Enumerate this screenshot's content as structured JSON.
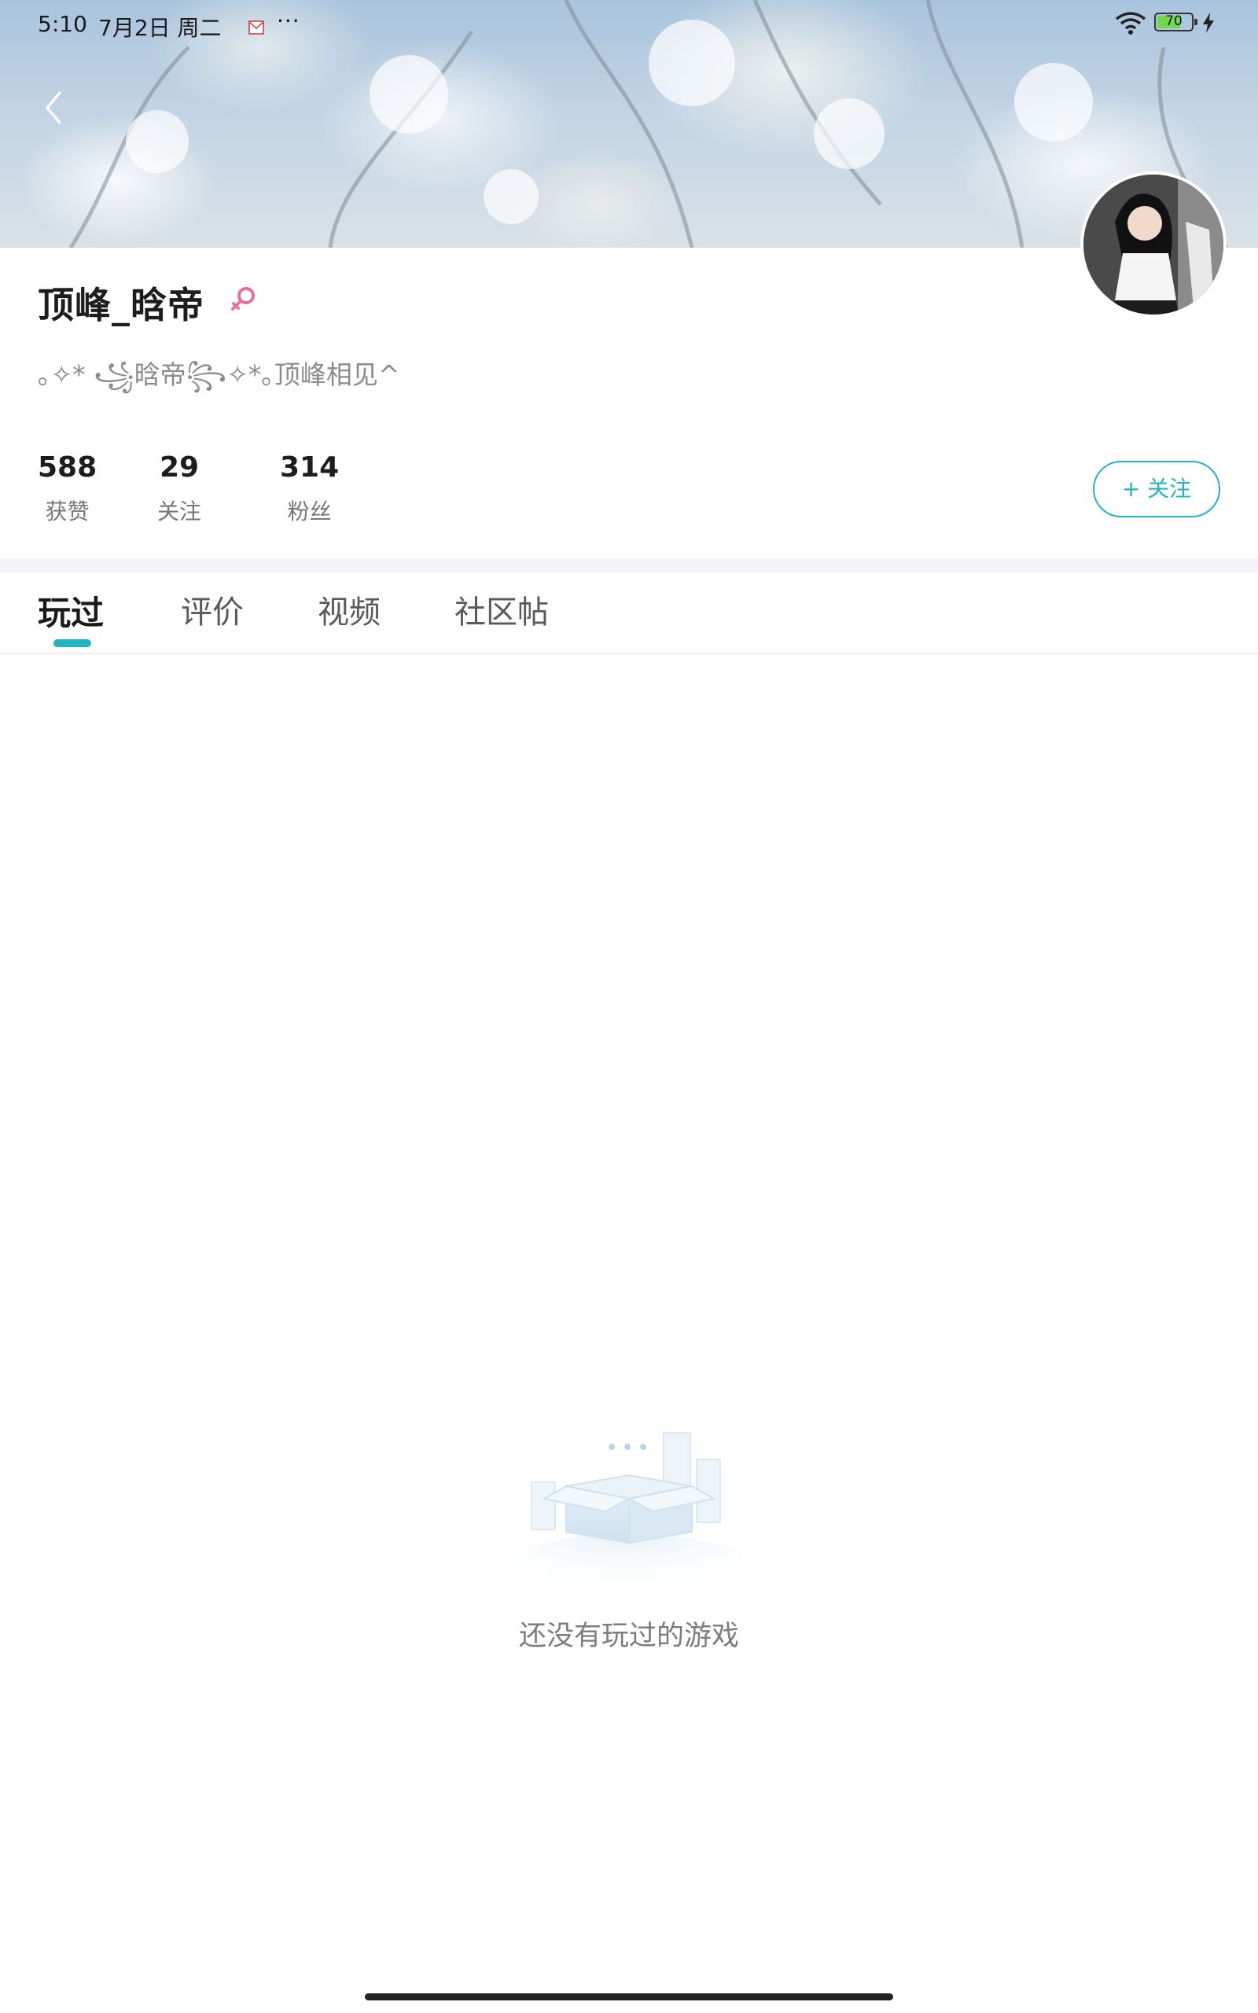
{
  "status_bar": {
    "time": "5:10",
    "date": "7月2日 周二",
    "more": "···",
    "battery_level": "70",
    "battery_fraction": 0.7,
    "battery_color": "#72d64e"
  },
  "profile": {
    "username": "顶峰_晗帝",
    "gender": "female",
    "bio": "｡✧* ꧁晗帝꧂✧*｡顶峰相见^",
    "stats": [
      {
        "value": "588",
        "label": "获赞"
      },
      {
        "value": "29",
        "label": "关注"
      },
      {
        "value": "314",
        "label": "粉丝"
      }
    ],
    "follow_label": "+ 关注"
  },
  "tabs": [
    {
      "label": "玩过",
      "active": true
    },
    {
      "label": "评价",
      "active": false
    },
    {
      "label": "视频",
      "active": false
    },
    {
      "label": "社区帖",
      "active": false
    }
  ],
  "empty_state": {
    "message": "还没有玩过的游戏"
  },
  "colors": {
    "accent": "#24b3c0",
    "gender_icon": "#e8719b"
  },
  "icons": {
    "back": "chevron-left-icon",
    "notification": "mail-notification-icon",
    "wifi": "wifi-icon",
    "battery": "battery-icon",
    "charging": "lightning-icon",
    "gender": "female-symbol-icon",
    "empty": "empty-box-icon"
  }
}
